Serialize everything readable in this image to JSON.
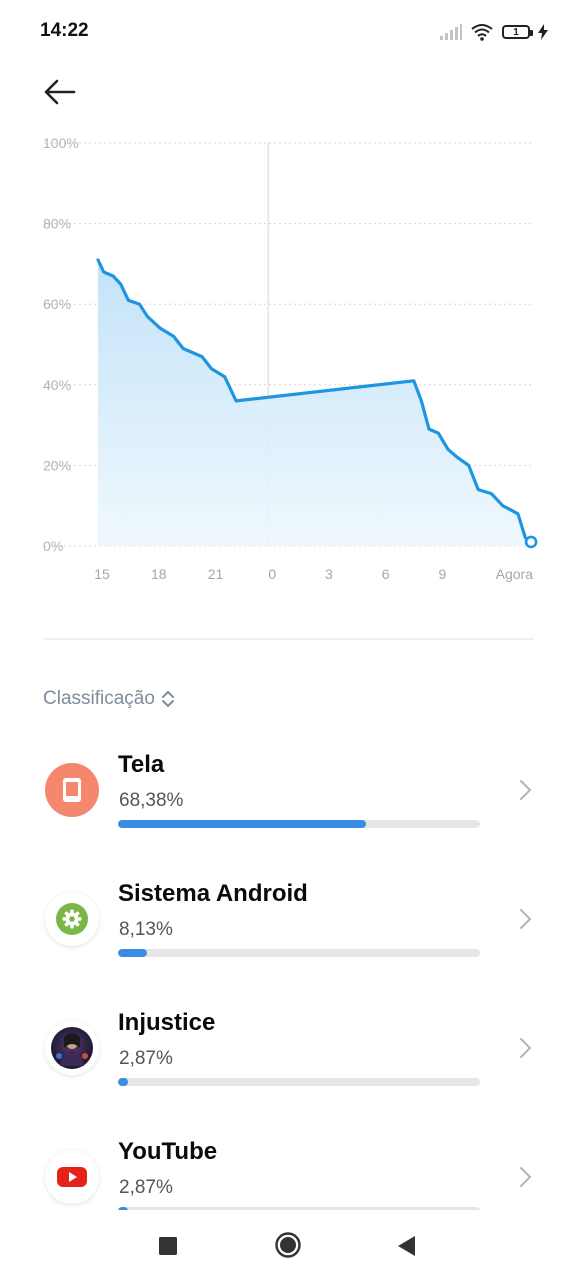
{
  "status_bar": {
    "time": "14:22",
    "battery_level": "1",
    "icons": [
      "signal-icon",
      "wifi-icon",
      "battery-icon",
      "charging-icon"
    ]
  },
  "header": {
    "back_icon": "arrow-left-icon"
  },
  "chart_data": {
    "type": "area",
    "y_ticks": [
      "100%",
      "80%",
      "60%",
      "40%",
      "20%",
      "0%"
    ],
    "x_ticks": [
      "15",
      "18",
      "21",
      "0",
      "3",
      "6",
      "9",
      "Agora"
    ],
    "ylim": [
      0,
      100
    ],
    "grid": true,
    "line_color": "#1e95e0",
    "series": [
      {
        "x": [
          15.0,
          15.3,
          15.8,
          16.2,
          16.6,
          17.2,
          17.6,
          18.3,
          19.0,
          19.5,
          20.0,
          20.5,
          21.0,
          21.7,
          22.3,
          7.7,
          8.1,
          8.5,
          9.0,
          9.5,
          10.0,
          10.6,
          11.1,
          11.8,
          12.4,
          12.8,
          13.2,
          13.6,
          13.9
        ],
        "y": [
          71,
          68,
          67,
          65,
          61,
          60,
          57,
          54,
          52,
          49,
          48,
          47,
          44,
          42,
          36,
          41,
          36,
          29,
          28,
          24,
          22,
          20,
          14,
          13,
          10,
          9,
          8,
          2,
          1
        ]
      }
    ]
  },
  "list": {
    "sort_label": "Classificação",
    "apps": [
      {
        "name": "Tela",
        "percent": "68,38%",
        "share": 68.38,
        "icon": "screen-icon"
      },
      {
        "name": "Sistema Android",
        "percent": "8,13%",
        "share": 8.13,
        "icon": "android-system-gear-icon"
      },
      {
        "name": "Injustice",
        "percent": "2,87%",
        "share": 2.87,
        "icon": "injustice-app-icon"
      },
      {
        "name": "YouTube",
        "percent": "2,87%",
        "share": 2.87,
        "icon": "youtube-icon"
      }
    ]
  },
  "colors": {
    "accent": "#3b8de3",
    "tela_icon": "#f5876f",
    "android_icon": "#7ab648",
    "youtube_red": "#e4211b"
  },
  "nav_bar": {
    "buttons": [
      "recents-button",
      "home-button",
      "back-button"
    ]
  }
}
